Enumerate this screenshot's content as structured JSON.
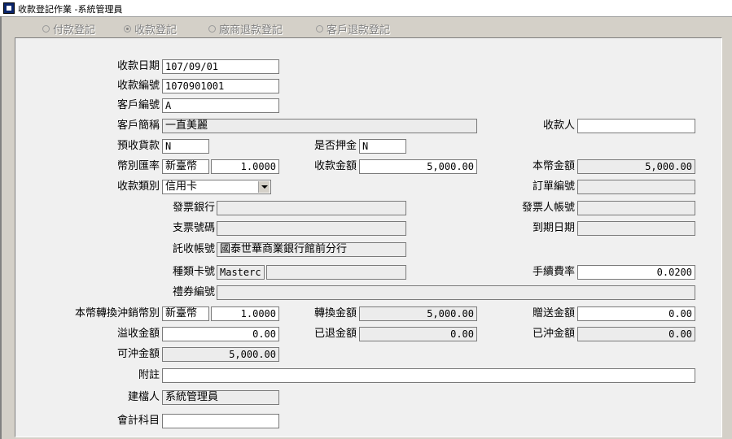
{
  "window": {
    "title": "收款登記作業 -系統管理員"
  },
  "mode_radios": [
    {
      "label": "付款登記",
      "selected": false
    },
    {
      "label": "收款登記",
      "selected": true
    },
    {
      "label": "廠商退款登記",
      "selected": false
    },
    {
      "label": "客戶退款登記",
      "selected": false
    }
  ],
  "form": {
    "receipt_date": {
      "label": "收款日期",
      "value": "107/09/01"
    },
    "receipt_no": {
      "label": "收款編號",
      "value": "1070901001"
    },
    "customer_no": {
      "label": "客戶編號",
      "value": "A"
    },
    "customer_name": {
      "label": "客戶簡稱",
      "value": "一直美麗"
    },
    "collector": {
      "label": "收款人",
      "value": ""
    },
    "prepaid": {
      "label": "預收貨款",
      "value": "N"
    },
    "is_deposit": {
      "label": "是否押金",
      "value": "N"
    },
    "currency_rate": {
      "label": "幣別匯率",
      "currency": "新臺幣",
      "rate": "1.0000"
    },
    "receipt_amount": {
      "label": "收款金額",
      "value": "5,000.00"
    },
    "local_amount": {
      "label": "本幣金額",
      "value": "5,000.00"
    },
    "receipt_type": {
      "label": "收款類別",
      "value": "信用卡"
    },
    "order_no": {
      "label": "訂單編號",
      "value": ""
    },
    "issuing_bank": {
      "label": "發票銀行",
      "value": ""
    },
    "issuer_account": {
      "label": "發票人帳號",
      "value": ""
    },
    "check_no": {
      "label": "支票號碼",
      "value": ""
    },
    "due_date": {
      "label": "到期日期",
      "value": ""
    },
    "collection_account": {
      "label": "託收帳號",
      "value": "國泰世華商業銀行館前分行"
    },
    "card_type_no": {
      "label": "種類卡號",
      "type": "Masterc",
      "number": ""
    },
    "fee_rate": {
      "label": "手續費率",
      "value": "0.0200"
    },
    "voucher_no": {
      "label": "禮券編號",
      "value": ""
    },
    "offset_currency": {
      "label": "本幣轉換沖銷幣別",
      "currency": "新臺幣",
      "rate": "1.0000"
    },
    "converted_amount": {
      "label": "轉換金額",
      "value": "5,000.00"
    },
    "gift_amount": {
      "label": "贈送金額",
      "value": "0.00"
    },
    "overpaid_amount": {
      "label": "溢收金額",
      "value": "0.00"
    },
    "refunded_amount": {
      "label": "已退金額",
      "value": "0.00"
    },
    "offset_amount": {
      "label": "已沖金額",
      "value": "0.00"
    },
    "available_amount": {
      "label": "可沖金額",
      "value": "5,000.00"
    },
    "remarks": {
      "label": "附註",
      "value": ""
    },
    "creator": {
      "label": "建檔人",
      "value": "系統管理員"
    },
    "account_subject": {
      "label": "會計科目",
      "value": ""
    }
  }
}
